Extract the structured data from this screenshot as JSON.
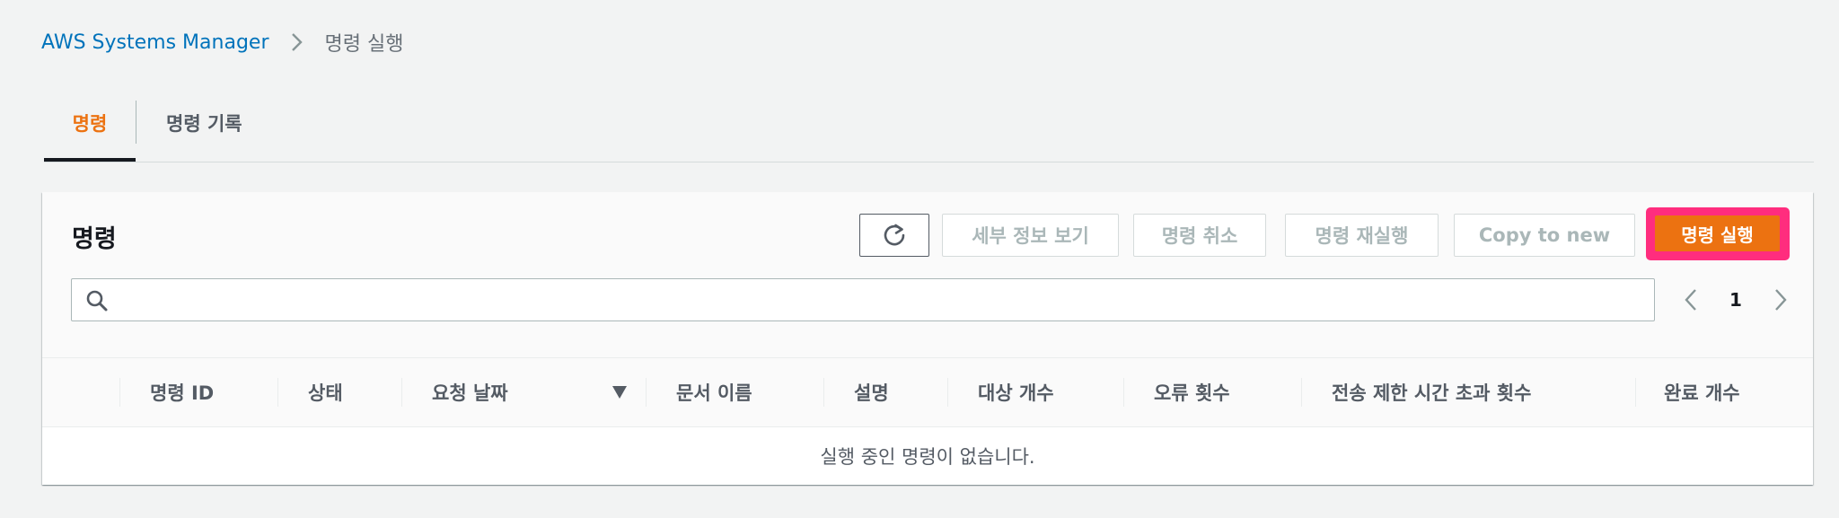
{
  "breadcrumb": {
    "root": "AWS Systems Manager",
    "current": "명령 실행"
  },
  "tabs": [
    {
      "label": "명령",
      "active": true
    },
    {
      "label": "명령 기록",
      "active": false
    }
  ],
  "panel": {
    "title": "명령",
    "buttons": {
      "detail": "세부 정보 보기",
      "cancel": "명령 취소",
      "rerun": "명령 재실행",
      "copy": "Copy to new",
      "run": "명령 실행"
    },
    "search": {
      "value": "",
      "placeholder": ""
    },
    "pagination": {
      "current_page": "1"
    }
  },
  "table": {
    "columns": [
      "명령 ID",
      "상태",
      "요청 날짜",
      "문서 이름",
      "설명",
      "대상 개수",
      "오류 횟수",
      "전송 제한 시간 초과 횟수",
      "완료 개수"
    ],
    "empty_message": "실행 중인 명령이 없습니다."
  },
  "colors": {
    "accent_orange": "#ec7211",
    "highlight_pink": "#ff2d7e",
    "link_blue": "#0073bb"
  },
  "icons": {
    "breadcrumb_separator": "chevron-right-icon",
    "refresh": "refresh-icon",
    "search": "search-icon",
    "prev_page": "chevron-left-icon",
    "next_page": "chevron-right-icon",
    "sort": "caret-down-icon"
  }
}
